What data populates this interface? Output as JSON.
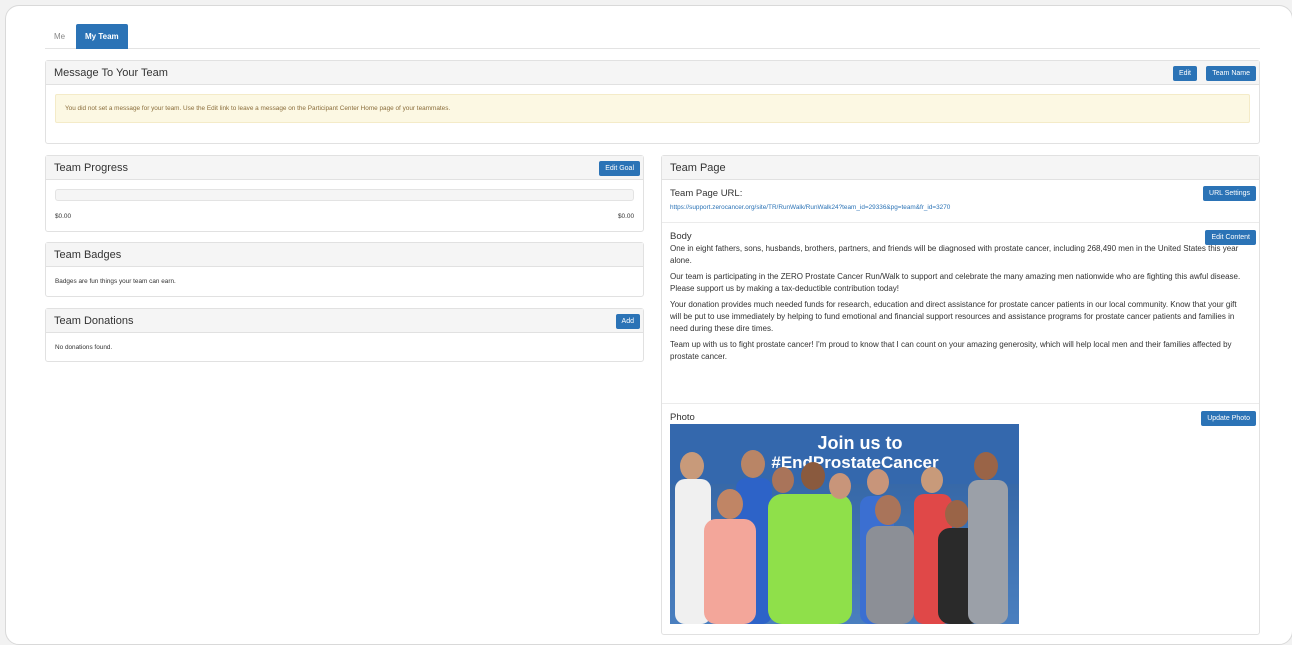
{
  "tabs": [
    {
      "label": "Me"
    },
    {
      "label": "My Team"
    }
  ],
  "message_panel": {
    "title": "Message To Your Team",
    "edit_label": "Edit",
    "team_name_label": "Team Name",
    "alert_text": "You did not set a message for your team. Use the Edit link to leave a message on the Participant Center Home page of your teammates."
  },
  "progress_panel": {
    "title": "Team Progress",
    "edit_goal_label": "Edit Goal",
    "progress_fraction": 0,
    "raised": "$0.00",
    "goal": "$0.00"
  },
  "badges_panel": {
    "title": "Team Badges",
    "text": "Badges are fun things your team can earn."
  },
  "donations_panel": {
    "title": "Team Donations",
    "add_label": "Add",
    "empty_text": "No donations found."
  },
  "team_page": {
    "title": "Team Page",
    "url_label": "Team Page URL:",
    "url_settings_label": "URL Settings",
    "url": "https://support.zerocancer.org/site/TR/RunWalk/RunWalk24?team_id=29336&pg=team&fr_id=3270",
    "body_label": "Body",
    "edit_content_label": "Edit Content",
    "paragraphs": [
      "One in eight fathers, sons, husbands, brothers, partners, and friends will be diagnosed with prostate cancer, including 268,490 men in the United States this year alone.",
      "Our team is participating in the ZERO Prostate Cancer Run/Walk to support and celebrate the many amazing men nationwide who are fighting this awful disease. Please support us by making a tax-deductible contribution today!",
      "Your donation provides much needed funds for research, education and direct assistance for prostate cancer patients in our local community. Know that your gift will be put to use immediately by helping to fund emotional and financial support resources and assistance programs for prostate cancer patients and families in need during these dire times.",
      "Team up with us to fight prostate cancer! I'm proud to know that I can count on your amazing generosity, which will help local men and their families affected by prostate cancer."
    ],
    "photo_label": "Photo",
    "update_photo_label": "Update Photo",
    "photo_banner_line1": "Join us to",
    "photo_banner_line2": "#EndProstateCancer"
  },
  "colors": {
    "accent": "#2b73b6",
    "alert_bg": "#fcf8e3",
    "alert_text": "#8a6d3b"
  }
}
